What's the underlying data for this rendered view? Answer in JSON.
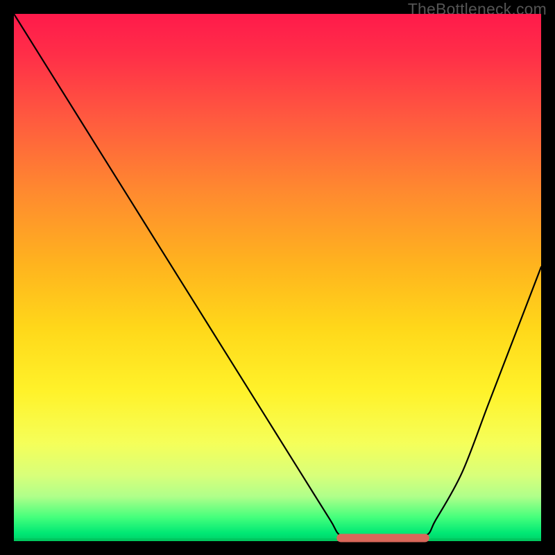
{
  "watermark": "TheBottleneck.com",
  "chart_data": {
    "type": "line",
    "title": "",
    "xlabel": "",
    "ylabel": "",
    "xlim": [
      0,
      100
    ],
    "ylim": [
      0,
      100
    ],
    "grid": false,
    "background": "bottleneck-gradient",
    "series": [
      {
        "name": "bottleneck-curve",
        "x": [
          0,
          5,
          10,
          15,
          20,
          25,
          30,
          35,
          40,
          45,
          50,
          55,
          60,
          62,
          66,
          72,
          78,
          80,
          85,
          90,
          95,
          100
        ],
        "y": [
          100,
          92,
          84,
          76,
          68,
          60,
          52,
          44,
          36,
          28,
          20,
          12,
          4,
          1,
          0,
          0,
          1,
          4,
          13,
          26,
          39,
          52
        ]
      }
    ],
    "annotations": [
      {
        "name": "optimal-range-marker",
        "kind": "line-segment",
        "color": "#d9675a",
        "x": [
          62,
          78
        ],
        "y": [
          0.6,
          0.6
        ]
      }
    ]
  }
}
